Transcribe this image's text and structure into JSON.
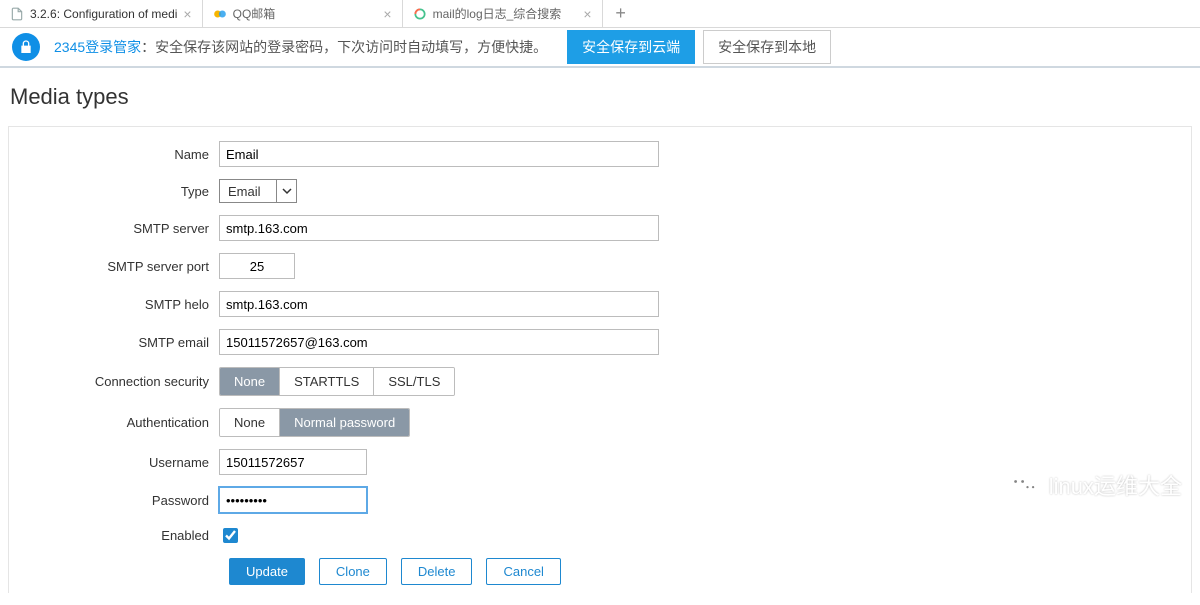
{
  "tabs": [
    {
      "title": "3.2.6: Configuration of medi",
      "icon": "doc"
    },
    {
      "title": "QQ邮箱",
      "icon": "qq"
    },
    {
      "title": "mail的log日志_综合搜索",
      "icon": "ring"
    }
  ],
  "password_bar": {
    "brand": "2345登录管家",
    "message": "：安全保存该网站的登录密码，下次访问时自动填写，方便快捷。",
    "save_cloud": "安全保存到云端",
    "save_local": "安全保存到本地"
  },
  "page": {
    "title": "Media types",
    "labels": {
      "name": "Name",
      "type": "Type",
      "smtp_server": "SMTP server",
      "smtp_port": "SMTP server port",
      "smtp_helo": "SMTP helo",
      "smtp_email": "SMTP email",
      "conn_sec": "Connection security",
      "auth": "Authentication",
      "username": "Username",
      "password": "Password",
      "enabled": "Enabled"
    },
    "values": {
      "name": "Email",
      "type": "Email",
      "smtp_server": "smtp.163.com",
      "smtp_port": "25",
      "smtp_helo": "smtp.163.com",
      "smtp_email": "15011572657@163.com",
      "username": "15011572657",
      "password": "•••••••••",
      "enabled": true
    },
    "conn_sec_opts": {
      "none": "None",
      "starttls": "STARTTLS",
      "ssl": "SSL/TLS",
      "selected": "none"
    },
    "auth_opts": {
      "none": "None",
      "normal": "Normal password",
      "selected": "normal"
    },
    "buttons": {
      "update": "Update",
      "clone": "Clone",
      "delete": "Delete",
      "cancel": "Cancel"
    }
  },
  "watermark": "linux运维大全"
}
